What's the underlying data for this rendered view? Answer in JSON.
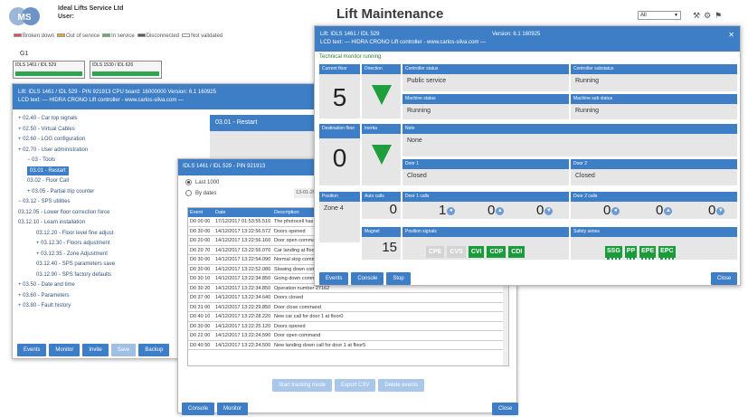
{
  "header": {
    "company": "Ideal Lifts Service Ltd",
    "user_label": "User:",
    "title": "Lift Maintenance",
    "select_value": "All"
  },
  "legend": [
    {
      "label": "Broken down",
      "color": "#d9534f"
    },
    {
      "label": "Out of service",
      "color": "#e8a33d"
    },
    {
      "label": "In service",
      "color": "#5cb85c"
    },
    {
      "label": "Disconnected",
      "color": "#5a5a5a"
    },
    {
      "label": "Not validated",
      "color": "#ffffff"
    }
  ],
  "group": "G1",
  "tiles": [
    "IDLS 1461 / IDL 529",
    "IDLS 1530 / IDL 626"
  ],
  "panel1": {
    "hdr1": "Lift: IDLS 1461 / IDL 529 - PIN 921913     CPU board: 16000000     Version: 6.1 160925",
    "hdr2": "LCD text: — HIDRA CRONO Lift controller - www.carlos-silva.com —",
    "tree": [
      "+ 02.40 - Car top signals",
      "+ 02.50 - Virtual Cables",
      "+ 02.60 - LOG configuration",
      "+ 02.70 - User administration",
      "− 03 - Tools",
      "03.01 - Restart",
      "03.02 - Floor Call",
      "+ 03.05 - Partial trip counter",
      "− 03.12 - SPS utilities",
      "03.12.05 - Lower floor correction force",
      "03.12.10 - Learn installation",
      "03.12.20 - Floor level fine adjust",
      "+ 03.12.30 - Floors adjustment",
      "+ 03.12.35 - Zone Adjustment",
      "03.12.40 - SPS parameters save",
      "03.12.90 - SPS factory defaults",
      "+ 03.50 - Date and time",
      "+ 03.60 - Parameters",
      "+ 03.80 - Fault history"
    ],
    "content_title": "03.01 - Restart",
    "buttons": [
      "Events",
      "Monitor",
      "Invite",
      "Save",
      "Backup"
    ]
  },
  "panel2": {
    "hdr": "IDLS 1461 / IDL 529 - PIN 921913",
    "opt1": "Last 1000",
    "opt2": "By dates",
    "date": "13-01-20",
    "cols": [
      "Event",
      "Date",
      "Description"
    ],
    "rows": [
      [
        "D0 00 00",
        "17/12/2017 01:53:55.510",
        "The photocell has b"
      ],
      [
        "D0 30 00",
        "14/12/2017 13:22:56.572",
        "Doors opened"
      ],
      [
        "D0 20 00",
        "14/12/2017 13:22:56.160",
        "Door open comman"
      ],
      [
        "D0 20 70",
        "14/12/2017 13:22:56.070",
        "Car landing at floor"
      ],
      [
        "D0 30 00",
        "14/12/2017 13:22:54.090",
        "Normal stop comm"
      ],
      [
        "D0 30 00",
        "14/12/2017 13:22:52.080",
        "Slowing down comm"
      ],
      [
        "D0 30 10",
        "14/12/2017 13:22:34.850",
        "Going down command"
      ],
      [
        "D0 30 20",
        "14/12/2017 13:22:34.850",
        "Operation number 27162"
      ],
      [
        "D0 37 00",
        "14/12/2017 13:22:34.640",
        "Doors closed"
      ],
      [
        "D0 31 00",
        "14/12/2017 13:22:29.850",
        "Door close command"
      ],
      [
        "D0 40 10",
        "14/12/2017 13:22:28.220",
        "New car call for door 1 at floor0"
      ],
      [
        "D0 30 00",
        "14/12/2017 13:22:25.120",
        "Doors opened"
      ],
      [
        "D0 22 00",
        "14/12/2017 13:22:24.590",
        "Door open command"
      ],
      [
        "D0 40 50",
        "14/12/2017 13:22:24.500",
        "New landing down call for door 1 at floor5"
      ]
    ],
    "actions": [
      "Start tracking mode",
      "Export CSV",
      "Delete events"
    ],
    "bottom": [
      "Console",
      "Monitor"
    ],
    "close": "Close"
  },
  "panel3": {
    "hdr1": "Lift: IDLS 1461 / IDL 529",
    "version": "Version: 6.1 160925",
    "hdr2": "LCD text: — HIDRA CRONO Lift controller - www.carlos-silva.com —",
    "monitor": "Technical monitor running",
    "current_floor_label": "Current floor",
    "current_floor": "5",
    "direction_label": "Direction",
    "ctrl_status_label": "Controller status",
    "ctrl_status": "Public service",
    "ctrl_sub_label": "Controller substatus",
    "ctrl_sub": "Running",
    "machine_label": "Machine status",
    "machine": "Running",
    "machine_sub_label": "Machine sub status",
    "machine_sub": "Running",
    "dest_label": "Destination floor",
    "dest": "0",
    "inertia_label": "Inertia",
    "note_label": "Note",
    "note": "None",
    "door1_label": "Door 1",
    "door1": "Closed",
    "door2_label": "Door 2",
    "door2": "Closed",
    "position_label": "Position",
    "position": "Zone 4",
    "autocalls_label": "Auto calls",
    "autocalls": "0",
    "door1calls_label": "Door 1 calls",
    "d1a": "1",
    "d1b": "0",
    "d1c": "0",
    "door2calls_label": "Door 2 calls",
    "d2a": "0",
    "d2b": "0",
    "d2c": "0",
    "magnet_label": "Magnet",
    "magnet": "15",
    "possig_label": "Position signals",
    "signals": [
      {
        "t": "CPE",
        "on": false
      },
      {
        "t": "CVS",
        "on": false
      },
      {
        "t": "CVI",
        "on": true
      },
      {
        "t": "CDP",
        "on": true
      },
      {
        "t": "CDI",
        "on": true
      }
    ],
    "safety_label": "Safety series",
    "safety": [
      "SSG",
      "PP",
      "EPE",
      "EPC"
    ],
    "buttons": [
      "Events",
      "Console",
      "Stop"
    ],
    "close": "Close"
  }
}
